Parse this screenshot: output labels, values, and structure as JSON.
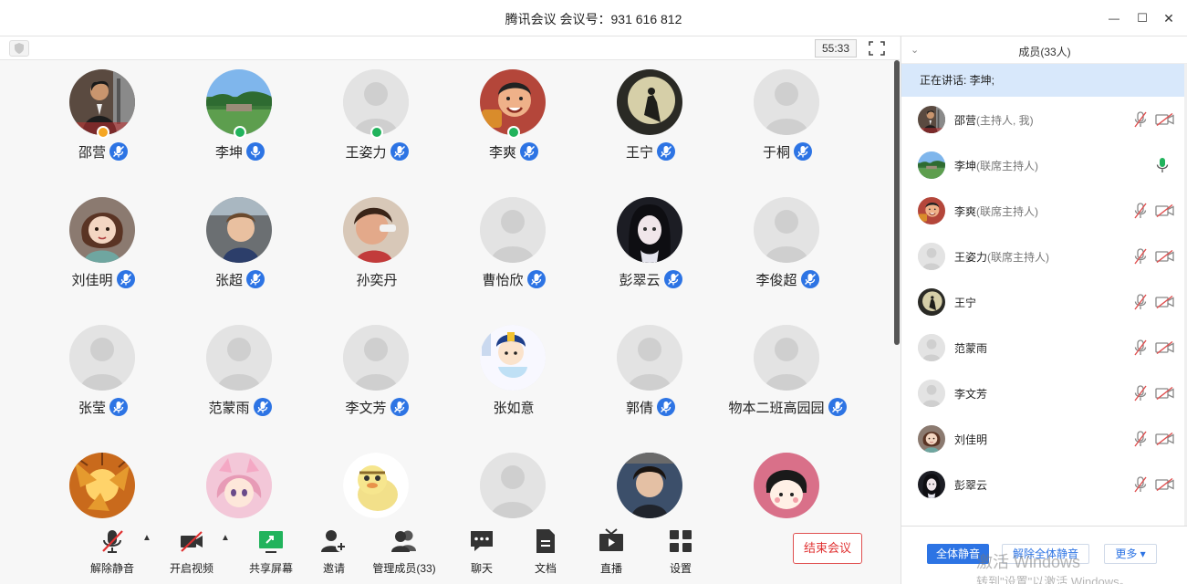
{
  "window": {
    "title": "腾讯会议 会议号：931 616 812",
    "minimize": "—",
    "maximize": "☐",
    "close": "✕"
  },
  "meeting": {
    "timer": "55:33"
  },
  "participants": [
    {
      "name": "邵营",
      "avatar": "photo-man-suit",
      "badge": "orange-host",
      "mic": "muted"
    },
    {
      "name": "李坤",
      "avatar": "photo-landscape",
      "badge": "green-cohost",
      "mic": "active"
    },
    {
      "name": "王姿力",
      "avatar": "default",
      "badge": "green-cohost",
      "mic": "muted"
    },
    {
      "name": "李爽",
      "avatar": "photo-child",
      "badge": "green-cohost",
      "mic": "muted"
    },
    {
      "name": "王宁",
      "avatar": "photo-moon",
      "badge": "",
      "mic": "muted"
    },
    {
      "name": "于桐",
      "avatar": "default",
      "badge": "",
      "mic": "muted"
    },
    {
      "name": "刘佳明",
      "avatar": "cartoon-woman",
      "badge": "",
      "mic": "muted"
    },
    {
      "name": "张超",
      "avatar": "photo-boy",
      "badge": "",
      "mic": "muted"
    },
    {
      "name": "孙奕丹",
      "avatar": "photo-girl",
      "badge": "",
      "mic": "none"
    },
    {
      "name": "曹怡欣",
      "avatar": "default",
      "badge": "",
      "mic": "muted"
    },
    {
      "name": "彭翠云",
      "avatar": "anime-girl",
      "badge": "",
      "mic": "muted"
    },
    {
      "name": "李俊超",
      "avatar": "default",
      "badge": "",
      "mic": "muted"
    },
    {
      "name": "张莹",
      "avatar": "default",
      "badge": "",
      "mic": "muted"
    },
    {
      "name": "范蒙雨",
      "avatar": "default",
      "badge": "",
      "mic": "muted"
    },
    {
      "name": "李文芳",
      "avatar": "default",
      "badge": "",
      "mic": "muted"
    },
    {
      "name": "张如意",
      "avatar": "cartoon-prince",
      "badge": "",
      "mic": "none"
    },
    {
      "name": "郭倩",
      "avatar": "default",
      "badge": "",
      "mic": "muted"
    },
    {
      "name": "物本二班高园园",
      "avatar": "default",
      "badge": "",
      "mic": "muted"
    },
    {
      "name": "",
      "avatar": "photo-leaves",
      "badge": "",
      "mic": "none"
    },
    {
      "name": "",
      "avatar": "anime-pink",
      "badge": "",
      "mic": "none"
    },
    {
      "name": "",
      "avatar": "cartoon-duck",
      "badge": "",
      "mic": "none"
    },
    {
      "name": "",
      "avatar": "default",
      "badge": "",
      "mic": "none"
    },
    {
      "name": "",
      "avatar": "photo-boy2",
      "badge": "",
      "mic": "none"
    },
    {
      "name": "",
      "avatar": "cartoon-maruko",
      "badge": "",
      "mic": "none"
    }
  ],
  "toolbar": {
    "unmute": "解除静音",
    "start_video": "开启视频",
    "share_screen": "共享屏幕",
    "invite": "邀请",
    "manage_members": "管理成员(33)",
    "chat": "聊天",
    "docs": "文档",
    "live": "直播",
    "settings": "设置",
    "end_meeting": "结束会议"
  },
  "sidebar": {
    "title": "成员(33人)",
    "speaking": "正在讲话: 李坤;",
    "members": [
      {
        "name": "邵营",
        "role": "(主持人, 我)",
        "avatar": "photo-man-suit",
        "mic": "muted",
        "cam": "off"
      },
      {
        "name": "李坤",
        "role": "(联席主持人)",
        "avatar": "photo-landscape",
        "mic": "active",
        "cam": "none"
      },
      {
        "name": "李爽",
        "role": "(联席主持人)",
        "avatar": "photo-child",
        "mic": "muted",
        "cam": "off"
      },
      {
        "name": "王姿力",
        "role": "(联席主持人)",
        "avatar": "default",
        "mic": "muted",
        "cam": "off"
      },
      {
        "name": " 王宁",
        "role": "",
        "avatar": "photo-moon",
        "mic": "muted",
        "cam": "off"
      },
      {
        "name": "范蒙雨",
        "role": "",
        "avatar": "default",
        "mic": "muted",
        "cam": "off"
      },
      {
        "name": "李文芳",
        "role": "",
        "avatar": "default",
        "mic": "muted",
        "cam": "off"
      },
      {
        "name": "刘佳明",
        "role": "",
        "avatar": "cartoon-woman",
        "mic": "muted",
        "cam": "off"
      },
      {
        "name": "彭翠云",
        "role": "",
        "avatar": "anime-girl",
        "mic": "muted",
        "cam": "off"
      }
    ],
    "mute_all": "全体静音",
    "unmute_all": "解除全体静音",
    "more": "更多 ▾"
  },
  "watermark": {
    "line1": "激活 Windows",
    "line2": "转到\"设置\"以激活 Windows。"
  },
  "colors": {
    "accent": "#2d74e4",
    "end": "#e03030",
    "speaking_bg": "#d8e8fb",
    "host_badge": "#f5a623",
    "cohost_badge": "#21b35c",
    "active_mic": "#21b35c"
  }
}
